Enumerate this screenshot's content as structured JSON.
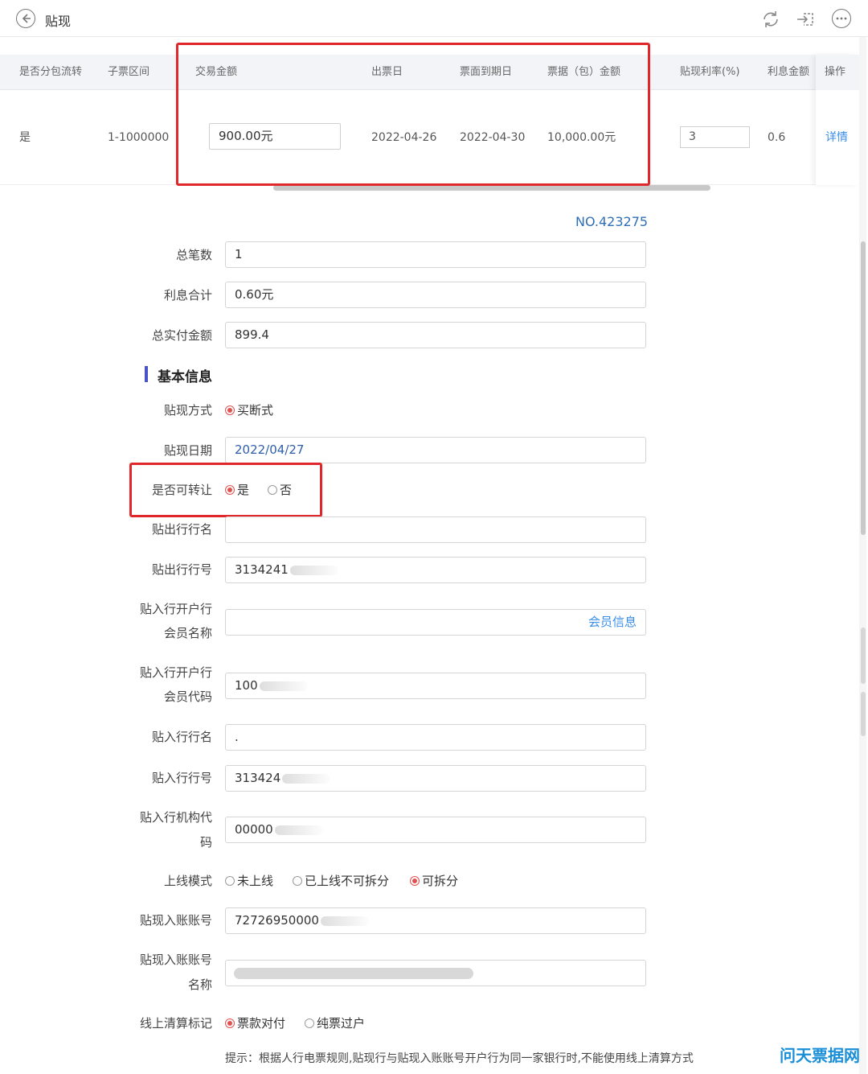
{
  "header": {
    "title": "贴现"
  },
  "table": {
    "columns": [
      "是否分包流转",
      "子票区间",
      "交易金额",
      "出票日",
      "票面到期日",
      "票据（包）金额",
      "贴现利率(%)",
      "利息金额",
      "操作"
    ],
    "row": {
      "split": "是",
      "range": "1-1000000",
      "amount": "900.00元",
      "issue_date": "2022-04-26",
      "due_date": "2022-04-30",
      "bill_amount": "10,000.00元",
      "rate": "3",
      "interest": "0.6",
      "action": "详情"
    }
  },
  "form": {
    "number": "NO.423275",
    "total_count": {
      "label": "总笔数",
      "value": "1"
    },
    "interest_total": {
      "label": "利息合计",
      "value": "0.60元"
    },
    "total_paid": {
      "label": "总实付金额",
      "value": "899.4"
    },
    "section_title": "基本信息",
    "discount_mode": {
      "label": "贴现方式",
      "option": "买断式"
    },
    "discount_date": {
      "label": "贴现日期",
      "value": "2022/04/27"
    },
    "transferable": {
      "label": "是否可转让",
      "yes": "是",
      "no": "否",
      "selected": "是"
    },
    "out_bank_name": {
      "label": "贴出行行名",
      "value": ""
    },
    "out_bank_no": {
      "label": "贴出行行号",
      "value": "3134241"
    },
    "in_member_name": {
      "label1": "贴入行开户行",
      "label2": "会员名称",
      "value": "",
      "link": "会员信息"
    },
    "in_member_code": {
      "label1": "贴入行开户行",
      "label2": "会员代码",
      "value": "100"
    },
    "in_bank_name": {
      "label": "贴入行行名",
      "value": "."
    },
    "in_bank_no": {
      "label": "贴入行行号",
      "value": "313424"
    },
    "in_org_code": {
      "label1": "贴入行机构代",
      "label2": "码",
      "value": "00000"
    },
    "online_mode": {
      "label": "上线模式",
      "options": [
        "未上线",
        "已上线不可拆分",
        "可拆分"
      ],
      "selected": "可拆分"
    },
    "account_no": {
      "label": "贴现入账账号",
      "value": "72726950000"
    },
    "account_name": {
      "label1": "贴现入账账号",
      "label2": "名称",
      "value": ""
    },
    "clearing": {
      "label": "线上清算标记",
      "options": [
        "票款对付",
        "纯票过户"
      ],
      "selected": "票款对付"
    },
    "hint": "提示：根据人行电票规则,贴现行与贴现入账账号开户行为同一家银行时,不能使用线上清算方式"
  },
  "watermark": "问天票据网",
  "colors": {
    "highlight_box": "#e0272c",
    "link": "#3a8ee6",
    "radio_selected": "#e0524f",
    "section_bar": "#4b53c9"
  }
}
